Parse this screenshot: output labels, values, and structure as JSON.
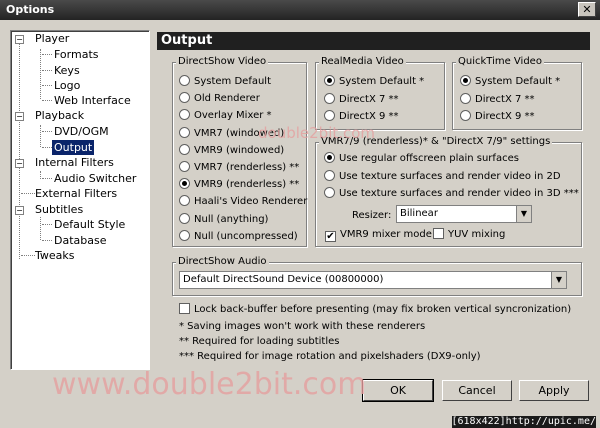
{
  "window": {
    "title": "Options",
    "close_glyph": "✕"
  },
  "tree": {
    "player": "Player",
    "formats": "Formats",
    "keys": "Keys",
    "logo": "Logo",
    "web_interface": "Web Interface",
    "playback": "Playback",
    "dvd_ogm": "DVD/OGM",
    "output": "Output",
    "internal_filters": "Internal Filters",
    "audio_switcher": "Audio Switcher",
    "external_filters": "External Filters",
    "subtitles": "Subtitles",
    "default_style": "Default Style",
    "database": "Database",
    "tweaks": "Tweaks"
  },
  "header": {
    "title": "Output"
  },
  "directshow_video": {
    "label": "DirectShow Video",
    "options": [
      "System Default",
      "Old Renderer",
      "Overlay Mixer *",
      "VMR7 (windowed)",
      "VMR9 (windowed)",
      "VMR7 (renderless) **",
      "VMR9 (renderless) **",
      "Haali's Video Renderer",
      "Null (anything)",
      "Null (uncompressed)"
    ],
    "selected": 6
  },
  "realmedia_video": {
    "label": "RealMedia Video",
    "options": [
      "System Default *",
      "DirectX 7 **",
      "DirectX 9 **"
    ],
    "selected": 0
  },
  "quicktime_video": {
    "label": "QuickTime Video",
    "options": [
      "System Default *",
      "DirectX 7 **",
      "DirectX 9 **"
    ],
    "selected": 0
  },
  "vmr_settings": {
    "label": "VMR7/9 (renderless)* & \"DirectX 7/9\" settings",
    "options": [
      "Use regular offscreen plain surfaces",
      "Use texture surfaces and render video in 2D",
      "Use texture surfaces and render video in 3D ***"
    ],
    "selected": 0,
    "resizer_label": "Resizer:",
    "resizer_value": "Bilinear",
    "vmr9_mixer_label": "VMR9 mixer mode",
    "vmr9_mixer_checked": true,
    "yuv_mixing_label": "YUV mixing",
    "yuv_mixing_checked": false
  },
  "directshow_audio": {
    "label": "DirectShow Audio",
    "device": "Default DirectSound Device (00800000)"
  },
  "lock_backbuffer": {
    "label": "Lock back-buffer before presenting (may fix broken vertical syncronization)",
    "checked": false
  },
  "notes": [
    "* Saving images won't work with these renderers",
    "** Required for loading subtitles",
    "*** Required for image rotation and pixelshaders (DX9-only)"
  ],
  "buttons": {
    "ok": "OK",
    "cancel": "Cancel",
    "apply": "Apply"
  },
  "watermark": {
    "large": "www.double2bit.com",
    "small": "double2bit.com"
  },
  "corner_caption": "[618x422]http://upic.me/"
}
